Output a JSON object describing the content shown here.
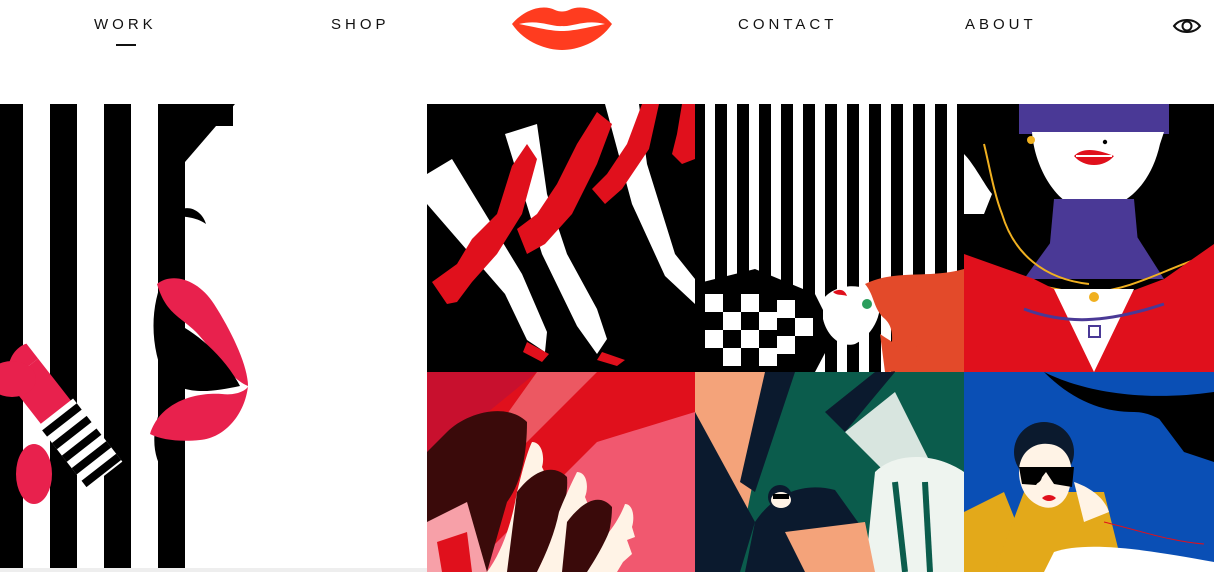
{
  "nav": {
    "work_label": "WORK",
    "shop_label": "SHOP",
    "contact_label": "CONTACT",
    "about_label": "ABOUT",
    "active": "WORK"
  },
  "icons": {
    "logo": "lips-logo-icon",
    "view_toggle": "eye-icon"
  },
  "colors": {
    "brand_red": "#ff3c1f",
    "lipstick": "#e8214d",
    "black": "#000000",
    "purple": "#4a3996",
    "green": "#0b5c4c",
    "blue": "#0a4fb5",
    "mustard": "#e3a91a"
  },
  "gallery": {
    "tiles": [
      "lipstick-stripes-artwork",
      "red-heels-artwork",
      "striped-redhead-artwork",
      "purple-necklace-artwork",
      "pink-profiles-artwork",
      "green-cabin-artwork",
      "blue-sunglasses-artwork"
    ]
  }
}
